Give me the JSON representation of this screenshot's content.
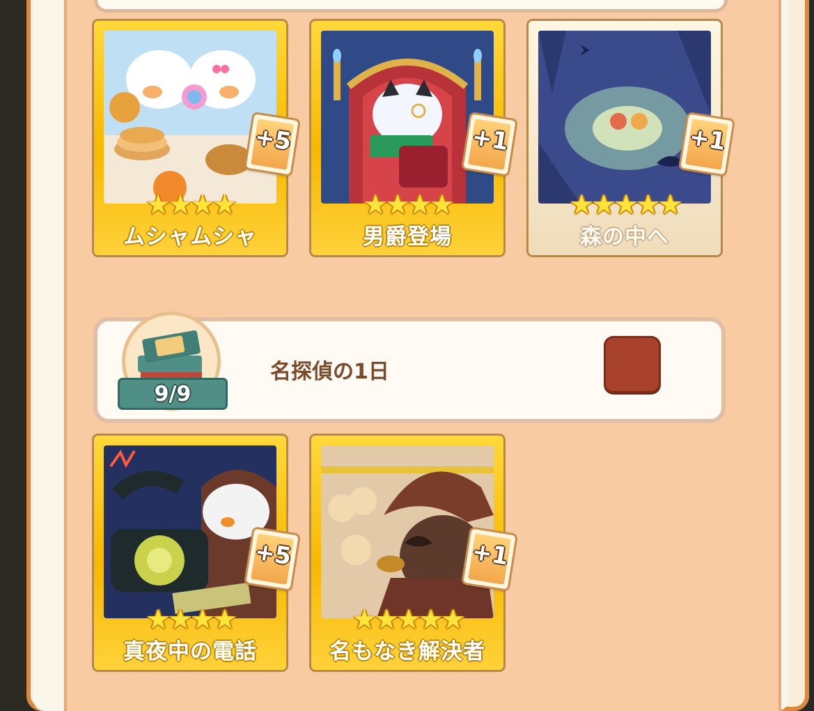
{
  "sections": [
    {
      "cards": [
        {
          "title": "ムシャムシャ",
          "badge": "+5",
          "stars": 4,
          "tier": "gold",
          "icon": "eating-party-art-icon"
        },
        {
          "title": "男爵登場",
          "badge": "+1",
          "stars": 4,
          "tier": "gold",
          "icon": "baron-reading-art-icon"
        },
        {
          "title": "森の中へ",
          "badge": "+1",
          "stars": 5,
          "tier": "silver",
          "icon": "night-forest-art-icon"
        }
      ]
    },
    {
      "chapter": {
        "title": "名探偵の1日",
        "progress": "9/9",
        "icon": "book-stack-icon",
        "button_color": "#a9422c"
      },
      "cards": [
        {
          "title": "真夜中の電話",
          "badge": "+5",
          "stars": 4,
          "tier": "gold",
          "icon": "midnight-phone-art-icon"
        },
        {
          "title": "名もなき解決者",
          "badge": "+1",
          "stars": 5,
          "tier": "gold",
          "icon": "detective-art-icon"
        }
      ]
    }
  ],
  "colors": {
    "panel": "#f9cba3",
    "gold": "#f7b800",
    "accent": "#a9422c"
  }
}
